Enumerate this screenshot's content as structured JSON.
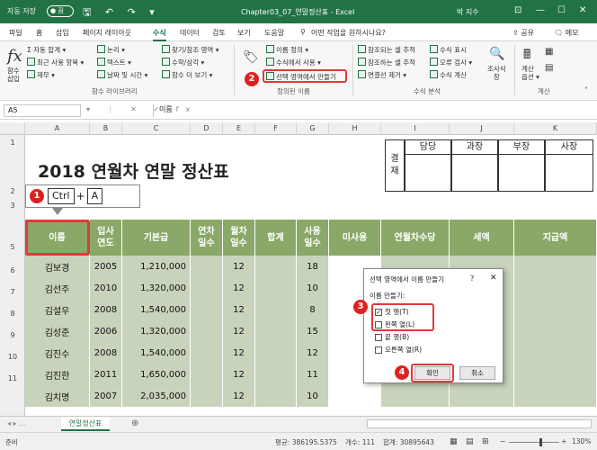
{
  "titlebar": {
    "autosave": "자동 저장",
    "toggle": "● 끔",
    "qat": "🖫 ↶ ↷ ▾",
    "doc": "Chapter03_07_연말정산표 - Excel",
    "user": "박 지수",
    "restore": "⊡",
    "min": "—",
    "max": "☐",
    "close": "✕"
  },
  "tabs": [
    "파일",
    "홈",
    "삽입",
    "페이지 레이아웃",
    "수식",
    "데이터",
    "검토",
    "보기",
    "도움말"
  ],
  "active_tab": "수식",
  "tellme": "어떤 작업을 원하시나요?",
  "share": "공유",
  "memo": "메모",
  "ribbon": {
    "fx_label": "함수\n삽입",
    "lib": [
      "자동 합계 ▾",
      "최근 사용 항목 ▾",
      "재무 ▾",
      "논리 ▾",
      "텍스트 ▾",
      "날짜 및 시간 ▾",
      "찾기/참조 영역 ▾",
      "수학/삼각 ▾",
      "함수 더 보기 ▾"
    ],
    "lib_group": "함수 라이브러리",
    "names": [
      "이름 정의 ▾",
      "수식에서 사용 ▾",
      "선택 영역에서 만들기"
    ],
    "names_group": "정의된 이름",
    "audit": [
      "참조되는 셀 추적",
      "참조하는 셀 추적",
      "연결선 제거 ▾",
      "수식 표시",
      "오류 검사 ▾",
      "수식 계산"
    ],
    "audit_group": "수식 분석",
    "watch": "조사식\n창",
    "calc": "계산\n옵션 ▾",
    "calc_group": "계산"
  },
  "namebox": "A5",
  "formula_buttons": "▾ ⋮ ✕ ✓ fx",
  "formula": "이름",
  "col_headers": [
    "A",
    "B",
    "C",
    "D",
    "E",
    "F",
    "G",
    "H",
    "I",
    "J",
    "K"
  ],
  "row_headers": [
    "1",
    "2",
    "3",
    "5",
    "6",
    "7",
    "8",
    "9",
    "10",
    "11"
  ],
  "sheet_title": "2018 연월차 연말 정산표",
  "approval": {
    "label": "결\n재",
    "roles": [
      "담당",
      "과장",
      "부장",
      "사장"
    ]
  },
  "shortcut": {
    "key1": "Ctrl",
    "plus": "+",
    "key2": "A"
  },
  "table_headers": [
    "이름",
    "입사\n연도",
    "기본급",
    "연차\n일수",
    "월차\n일수",
    "합계",
    "사용\n일수",
    "미사용",
    "연월차수당",
    "세액",
    "지급액"
  ],
  "rows": [
    [
      "김보경",
      "2005",
      "1,210,000",
      "",
      "12",
      "",
      "18"
    ],
    [
      "김선주",
      "2010",
      "1,320,000",
      "",
      "12",
      "",
      "10"
    ],
    [
      "김설우",
      "2008",
      "1,540,000",
      "",
      "12",
      "",
      "8"
    ],
    [
      "김성준",
      "2006",
      "1,320,000",
      "",
      "12",
      "",
      "15"
    ],
    [
      "김진수",
      "2008",
      "1,540,000",
      "",
      "12",
      "",
      "12"
    ],
    [
      "김진한",
      "2011",
      "1,650,000",
      "",
      "12",
      "",
      "11"
    ],
    [
      "김치명",
      "2007",
      "2,035,000",
      "",
      "12",
      "",
      "10"
    ]
  ],
  "dialog": {
    "title": "선택 영역에서 이름 만들기",
    "help": "?",
    "close": "✕",
    "group": "이름 만들기:",
    "options": [
      {
        "label": "첫 행(T)",
        "checked": true
      },
      {
        "label": "왼쪽 열(L)",
        "checked": false
      },
      {
        "label": "끝 행(B)",
        "checked": false
      },
      {
        "label": "오른쪽 열(R)",
        "checked": false
      }
    ],
    "ok": "확인",
    "cancel": "취소"
  },
  "badges": [
    "1",
    "2",
    "3",
    "4"
  ],
  "sheet_tab": "연말정산표",
  "status": {
    "ready": "준비",
    "avg": "평균: 386195.5375",
    "count": "개수: 111",
    "sum": "합계: 30895643",
    "zoom": "130%"
  },
  "colors": {
    "brand": "#217346",
    "header_fill": "#8aa867",
    "cell_fill": "#c8d3bb",
    "highlight": "#e03a3a"
  }
}
